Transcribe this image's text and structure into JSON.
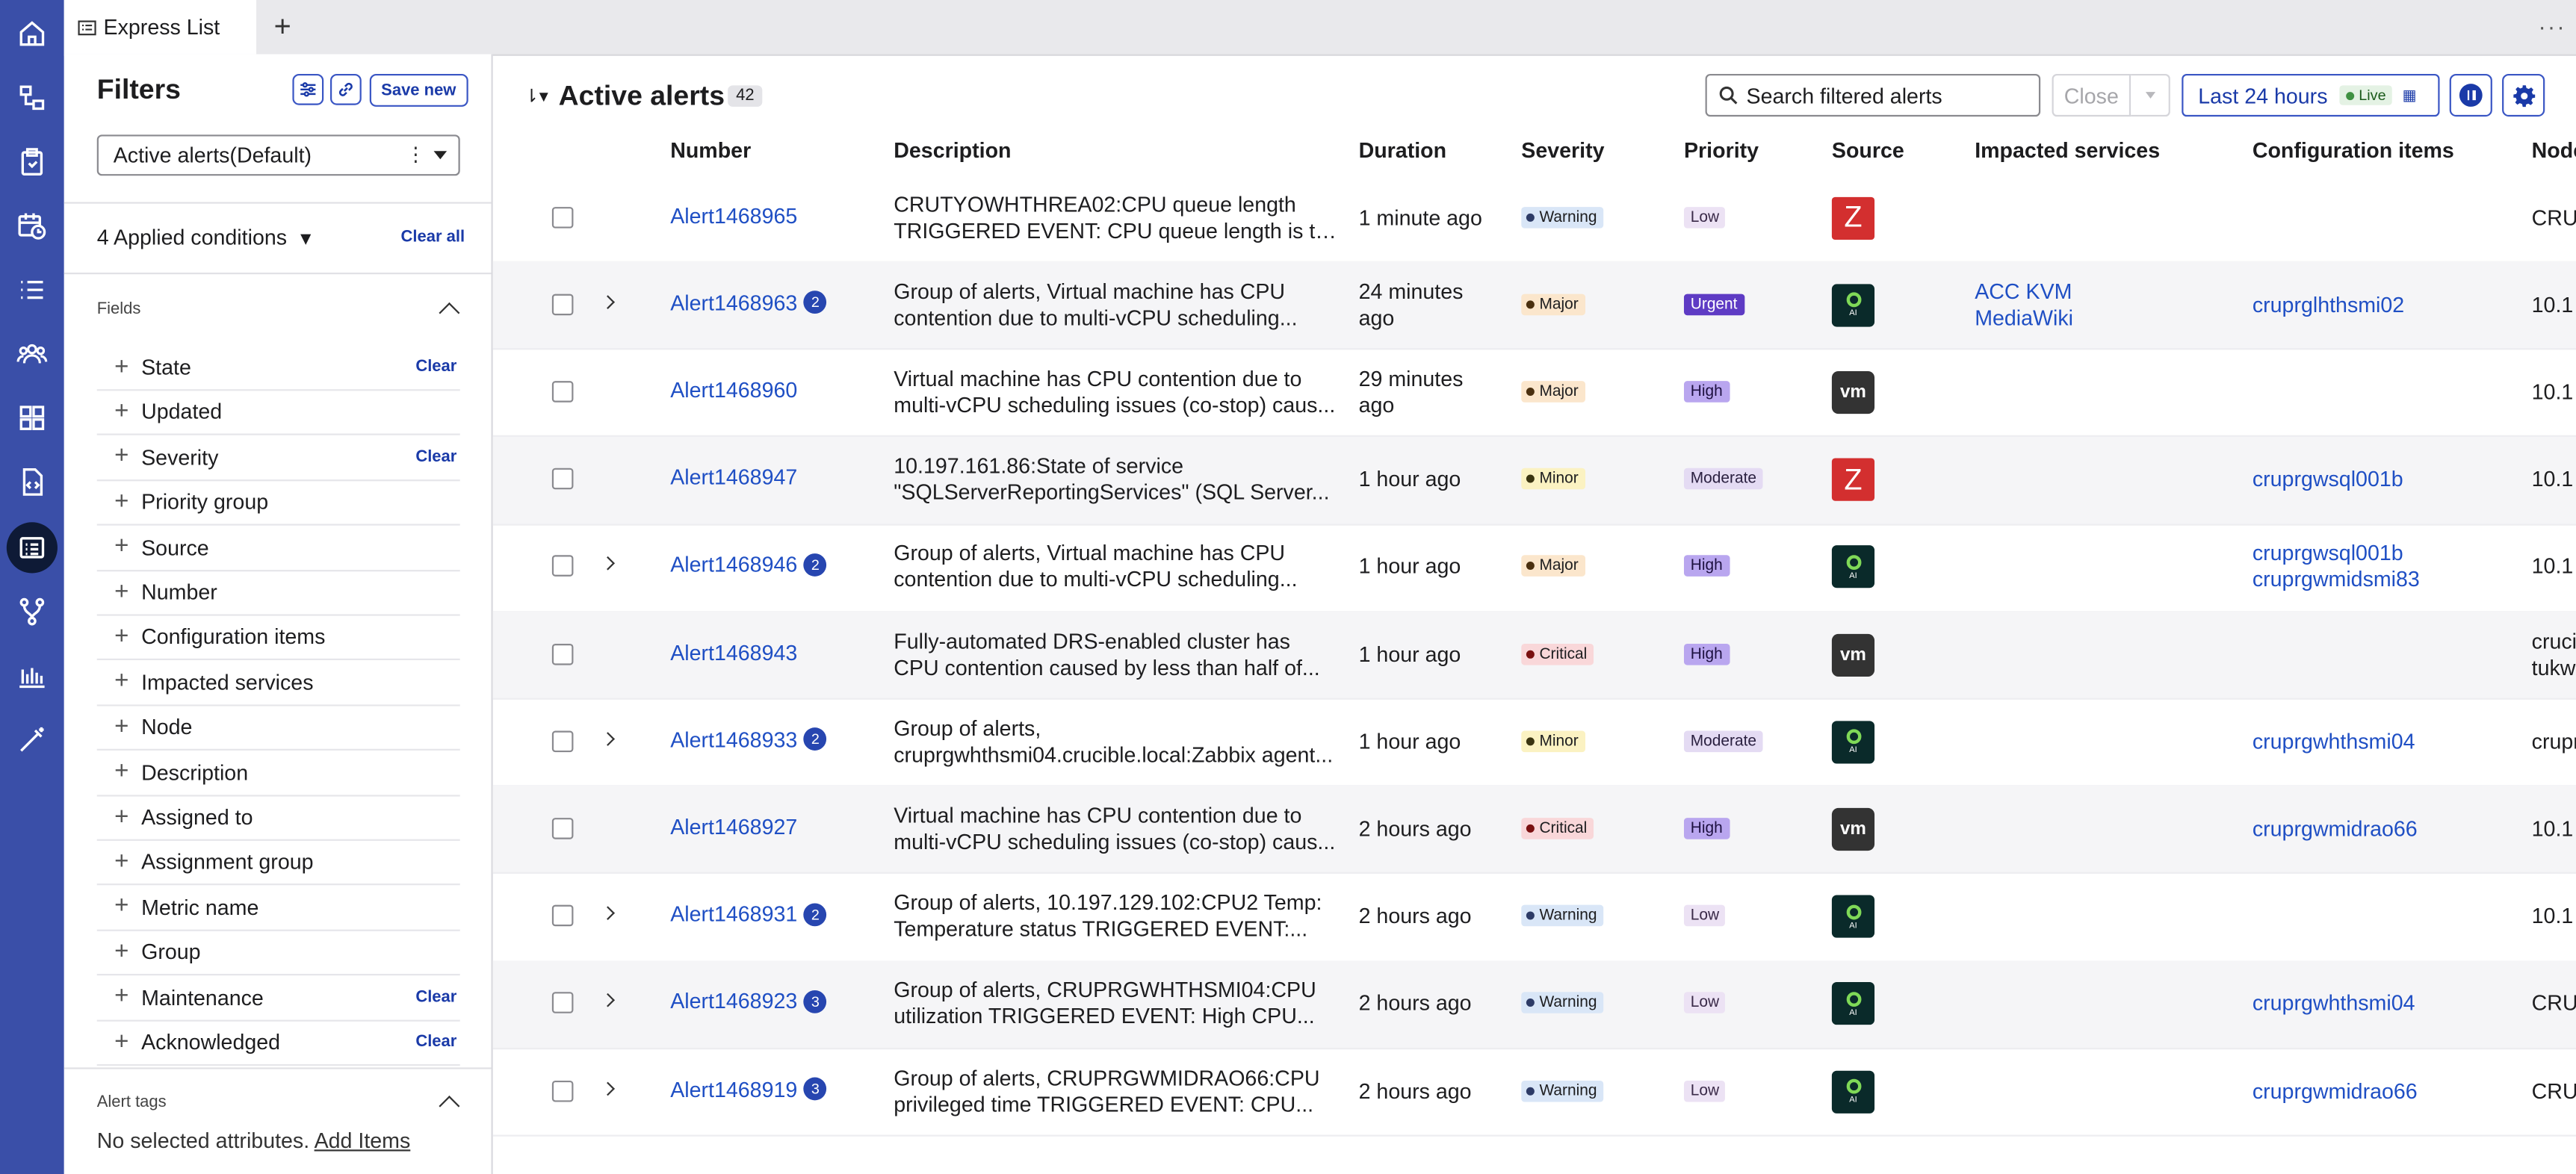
{
  "tab": {
    "title": "Express List",
    "add": "+",
    "more": "···"
  },
  "filters": {
    "title": "Filters",
    "save_new": "Save new",
    "selected_filter": "Active alerts(Default)",
    "applied": "4 Applied conditions",
    "clear_all": "Clear all",
    "fields_heading": "Fields",
    "fields": [
      {
        "label": "State",
        "clear": "Clear"
      },
      {
        "label": "Updated",
        "clear": ""
      },
      {
        "label": "Severity",
        "clear": "Clear"
      },
      {
        "label": "Priority group",
        "clear": ""
      },
      {
        "label": "Source",
        "clear": ""
      },
      {
        "label": "Number",
        "clear": ""
      },
      {
        "label": "Configuration items",
        "clear": ""
      },
      {
        "label": "Impacted services",
        "clear": ""
      },
      {
        "label": "Node",
        "clear": ""
      },
      {
        "label": "Description",
        "clear": ""
      },
      {
        "label": "Assigned to",
        "clear": ""
      },
      {
        "label": "Assignment group",
        "clear": ""
      },
      {
        "label": "Metric name",
        "clear": ""
      },
      {
        "label": "Group",
        "clear": ""
      },
      {
        "label": "Maintenance",
        "clear": "Clear"
      },
      {
        "label": "Acknowledged",
        "clear": "Clear"
      }
    ],
    "tags_heading": "Alert tags",
    "no_attr": "No selected attributes.",
    "add_items": "Add Items"
  },
  "main": {
    "title": "Active alerts",
    "count": "42",
    "search_placeholder": "Search filtered alerts",
    "close": "Close",
    "time_range": "Last 24 hours",
    "live": "Live"
  },
  "columns": [
    "Number",
    "Description",
    "Duration",
    "Severity",
    "Priority",
    "Source",
    "Impacted services",
    "Configuration items",
    "Node"
  ],
  "rows": [
    {
      "number": "Alert1468965",
      "badge": "",
      "expand": false,
      "desc": [
        "CRUTYOWHTHREA02:CPU queue length",
        "TRIGGERED EVENT: CPU queue length is to..."
      ],
      "duration": [
        "1 minute ago"
      ],
      "severity": "Warning",
      "priority": "Low",
      "source": "zabbix",
      "services": [],
      "cis": [],
      "node": [
        "CRU"
      ]
    },
    {
      "number": "Alert1468963",
      "badge": "2",
      "expand": true,
      "desc": [
        "Group of alerts, Virtual machine has CPU",
        "contention due to multi-vCPU scheduling..."
      ],
      "duration": [
        "24 minutes",
        "ago"
      ],
      "severity": "Major",
      "priority": "Urgent",
      "source": "ai",
      "services": [
        "ACC KVM",
        "MediaWiki"
      ],
      "cis": [
        "cruprglhthsmi02"
      ],
      "node": [
        "10.1"
      ]
    },
    {
      "number": "Alert1468960",
      "badge": "",
      "expand": false,
      "desc": [
        "Virtual machine has CPU contention due to",
        "multi-vCPU scheduling issues (co-stop) caus..."
      ],
      "duration": [
        "29 minutes",
        "ago"
      ],
      "severity": "Major",
      "priority": "High",
      "source": "vm",
      "services": [],
      "cis": [],
      "node": [
        "10.1"
      ]
    },
    {
      "number": "Alert1468947",
      "badge": "",
      "expand": false,
      "desc": [
        "10.197.161.86:State of service",
        "\"SQLServerReportingServices\" (SQL Server..."
      ],
      "duration": [
        "1 hour ago"
      ],
      "severity": "Minor",
      "priority": "Moderate",
      "source": "zabbix",
      "services": [],
      "cis": [
        "cruprgwsql001b"
      ],
      "node": [
        "10.1"
      ]
    },
    {
      "number": "Alert1468946",
      "badge": "2",
      "expand": true,
      "desc": [
        "Group of alerts, Virtual machine has CPU",
        "contention due to multi-vCPU scheduling..."
      ],
      "duration": [
        "1 hour ago"
      ],
      "severity": "Major",
      "priority": "High",
      "source": "ai",
      "services": [],
      "cis": [
        "cruprgwsql001b",
        "cruprgwmidsmi83"
      ],
      "node": [
        "10.1"
      ]
    },
    {
      "number": "Alert1468943",
      "badge": "",
      "expand": false,
      "desc": [
        "Fully-automated DRS-enabled cluster has",
        "CPU contention caused by less than half of..."
      ],
      "duration": [
        "1 hour ago"
      ],
      "severity": "Critical",
      "priority": "High",
      "source": "vm",
      "services": [],
      "cis": [],
      "node": [
        "cruci",
        "tukw"
      ]
    },
    {
      "number": "Alert1468933",
      "badge": "2",
      "expand": true,
      "desc": [
        "Group of alerts,",
        "cruprgwhthsmi04.crucible.local:Zabbix agent..."
      ],
      "duration": [
        "1 hour ago"
      ],
      "severity": "Minor",
      "priority": "Moderate",
      "source": "ai",
      "services": [],
      "cis": [
        "cruprgwhthsmi04"
      ],
      "node": [
        "crupr"
      ]
    },
    {
      "number": "Alert1468927",
      "badge": "",
      "expand": false,
      "desc": [
        "Virtual machine has CPU contention due to",
        "multi-vCPU scheduling issues (co-stop) caus..."
      ],
      "duration": [
        "2 hours ago"
      ],
      "severity": "Critical",
      "priority": "High",
      "source": "vm",
      "services": [],
      "cis": [
        "cruprgwmidrao66"
      ],
      "node": [
        "10.1"
      ]
    },
    {
      "number": "Alert1468931",
      "badge": "2",
      "expand": true,
      "desc": [
        "Group of alerts, 10.197.129.102:CPU2 Temp:",
        "Temperature status TRIGGERED EVENT:..."
      ],
      "duration": [
        "2 hours ago"
      ],
      "severity": "Warning",
      "priority": "Low",
      "source": "ai",
      "services": [],
      "cis": [],
      "node": [
        "10.1"
      ]
    },
    {
      "number": "Alert1468923",
      "badge": "3",
      "expand": true,
      "desc": [
        "Group of alerts, CRUPRGWHTHSMI04:CPU",
        "utilization TRIGGERED EVENT: High CPU..."
      ],
      "duration": [
        "2 hours ago"
      ],
      "severity": "Warning",
      "priority": "Low",
      "source": "ai",
      "services": [],
      "cis": [
        "cruprgwhthsmi04"
      ],
      "node": [
        "CRU"
      ]
    },
    {
      "number": "Alert1468919",
      "badge": "3",
      "expand": true,
      "desc": [
        "Group of alerts, CRUPRGWMIDRAO66:CPU",
        "privileged time TRIGGERED EVENT: CPU..."
      ],
      "duration": [
        "2 hours ago"
      ],
      "severity": "Warning",
      "priority": "Low",
      "source": "ai",
      "services": [],
      "cis": [
        "cruprgwmidrao66"
      ],
      "node": [
        "CRU"
      ]
    }
  ],
  "source_labels": {
    "zabbix": "Z",
    "vm": "vm",
    "ai": "AI"
  }
}
